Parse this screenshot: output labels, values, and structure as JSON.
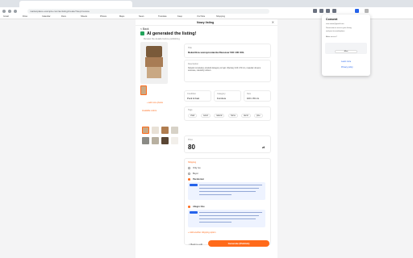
{
  "browser": {
    "url": "marketplace.example.com/ai-listing/create?step=review",
    "bookmarks": [
      "Gmail",
      "Drive",
      "Calendar",
      "Docs",
      "Sheets",
      "Photos",
      "Maps",
      "News",
      "Translate",
      "Keep",
      "YouTube",
      "Shopping"
    ]
  },
  "panel": {
    "header": "Nowy listing",
    "back": "< Back",
    "ai_title": "AI generated the listing!",
    "ai_sub": "Review the details before publishing",
    "image_note": "+ add more photos",
    "title_label": "Title",
    "title_value": "Dekoritiva szeroprostarola Rzeszow VIO 100 XXL",
    "desc_label": "Description",
    "desc_value": "Nowość w kolekcji, produkt dostępny od ręki. Wymiary 100 x 50 cm, materiał: drewno sosnowe, naturalny odcień.",
    "fields": [
      {
        "label": "Condition",
        "value": "Pock & Fast"
      },
      {
        "label": "Category",
        "value": "Furniture"
      },
      {
        "label": "Size",
        "value": "100 x 50 cm"
      }
    ],
    "tags_label": "Tags",
    "tags": [
      "chair",
      "wood",
      "natural",
      "home",
      "decor",
      "pine"
    ],
    "colors_label": "Available colors",
    "colors": [
      "#c9a884",
      "#e8e1d6",
      "#b07d4f",
      "#8a8a85",
      "#d7d2c7",
      "#5a4634",
      "#b8b0a0",
      "#f2efea"
    ],
    "price_label": "Price",
    "price": "80",
    "currency": "zł",
    "shipping_label": "Shipping",
    "options": [
      "Only me",
      "Buyer",
      "Paczkomat",
      "Allegro One"
    ],
    "ship_note": "+ Add another shipping option",
    "back_bottom": "< Back to edit",
    "cta": "Generate (Publish)"
  },
  "popup": {
    "title": "Consent",
    "lines": [
      "user.name@gmail.com",
      "Permission to access your listing",
      "and post to marketplace",
      "Allow access?"
    ],
    "allow": "Allow",
    "link1": "Learn more",
    "link2": "Privacy policy"
  }
}
